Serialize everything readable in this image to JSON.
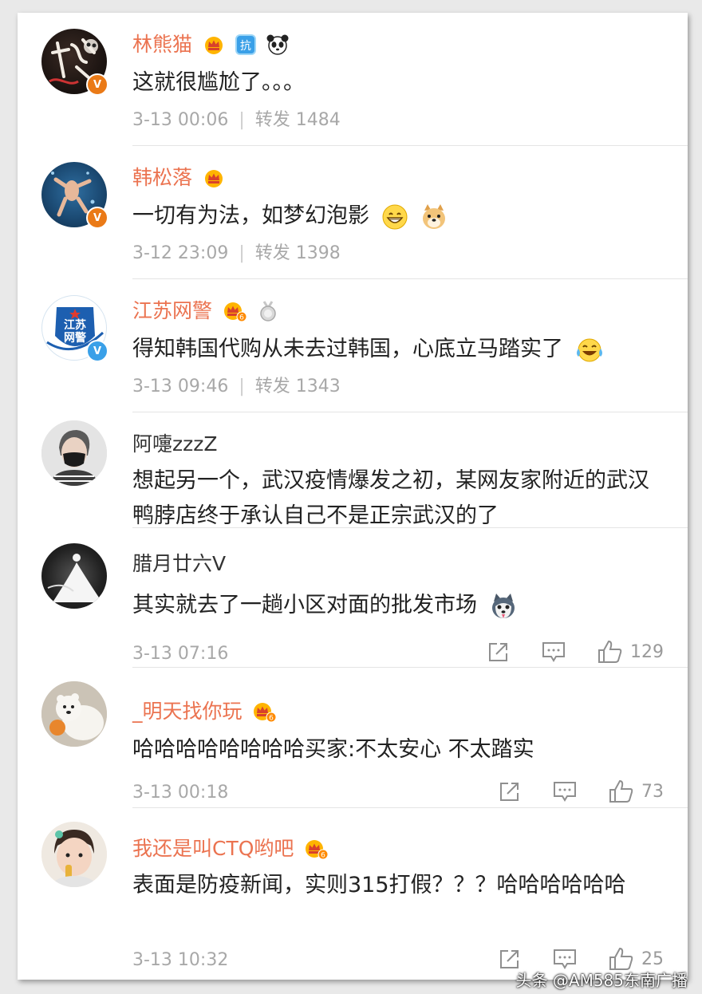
{
  "comments": [
    {
      "name": "林熊猫",
      "text": "这就很尴尬了。。。",
      "time": "3-13 00:06",
      "repost_label": "转发",
      "repost_count": "1484",
      "separator": "|"
    },
    {
      "name": "韩松落",
      "text": "一切有为法，如梦幻泡影",
      "time": "3-12 23:09",
      "repost_label": "转发",
      "repost_count": "1398",
      "separator": "|"
    },
    {
      "name": "江苏网警",
      "text": "得知韩国代购从未去过韩国，心底立马踏实了",
      "time": "3-13 09:46",
      "repost_label": "转发",
      "repost_count": "1343",
      "separator": "|",
      "avatar_text": "江苏\n网警"
    },
    {
      "name": "阿嚏zzzZ",
      "text": "想起另一个，武汉疫情爆发之初，某网友家附近的武汉鸭脖店终于承认自己不是正宗武汉的了"
    },
    {
      "name": "腊月廿六V",
      "text": "其实就去了一趟小区对面的批发市场",
      "time": "3-13 07:16",
      "like_count": "129"
    },
    {
      "name": "_明天找你玩",
      "text": "哈哈哈哈哈哈哈哈买家:不太安心 不太踏实",
      "time": "3-13 00:18",
      "like_count": "73"
    },
    {
      "name": "我还是叫CTQ哟吧",
      "text": "表面是防疫新闻，实则315打假？？？哈哈哈哈哈哈",
      "time": "3-13 10:32",
      "like_count": "25"
    }
  ],
  "badges": {
    "v": "V",
    "level_6": "6",
    "kang": "抗"
  },
  "icons": {
    "share": "share-icon",
    "comment": "comment-icon",
    "like": "like-icon",
    "crown": "vip-crown-icon",
    "panda": "panda-icon",
    "medal": "medal-icon"
  },
  "colors": {
    "vip_name": "#eb7350",
    "text": "#222222",
    "meta": "#a8a8a8",
    "orange_v": "#ea7a17",
    "blue_v": "#3aa0e8"
  },
  "watermark": "头条 @AM585东南广播"
}
